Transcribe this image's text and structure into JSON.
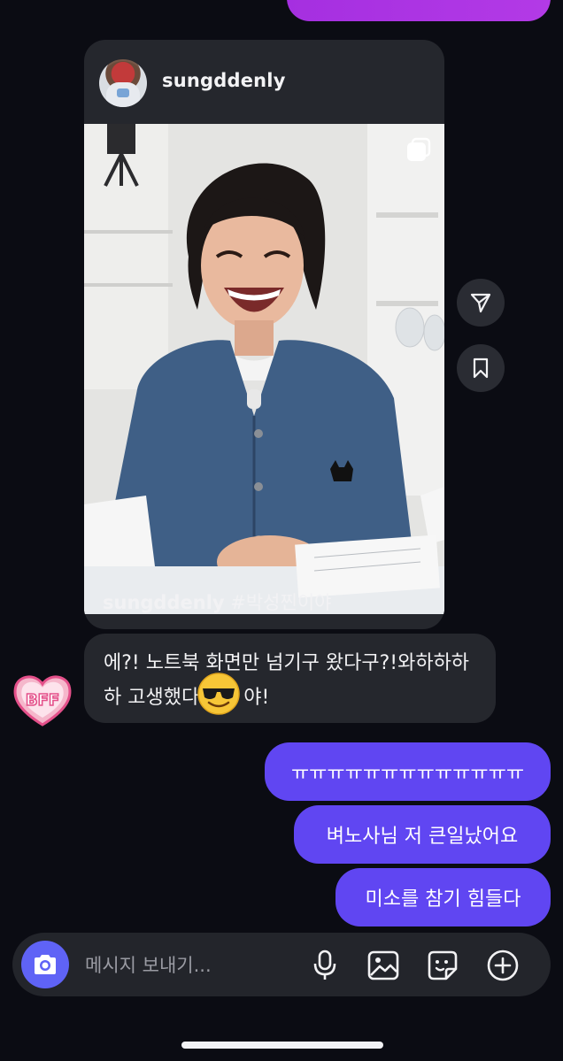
{
  "post": {
    "username": "sungddenly",
    "caption_user": "sungddenly",
    "caption_tag": "#박성찐이야"
  },
  "received": {
    "text_before": "에?! 노트북 화면만 넘기구 왔다구?!와하하하하 고생했다",
    "emoji": "smiling-face-with-sunglasses",
    "text_after": "야!"
  },
  "sent_messages": [
    "ㅠㅠㅠㅠㅠㅠㅠㅠㅠㅠㅠㅠㅠ",
    "벼노사님 저 큰일났어요",
    "미소를 참기 힘들다"
  ],
  "composer": {
    "placeholder": "메시지 보내기..."
  },
  "icons": {
    "share": "paper-plane-icon",
    "save": "bookmark-icon",
    "camera": "camera-icon",
    "mic": "microphone-icon",
    "gallery": "image-icon",
    "sticker": "sticker-icon",
    "add": "plus-circle-icon",
    "multi": "carousel-icon"
  },
  "colors": {
    "sent_bubble": "#6046f2",
    "camera_button": "#5f63f6",
    "top_bubble": "#b33ae6",
    "background": "#0b0c13",
    "card": "#25272d"
  }
}
